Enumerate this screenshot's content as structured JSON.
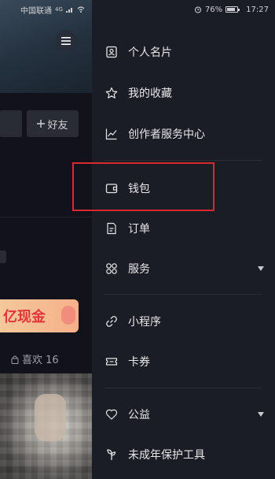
{
  "status_bar": {
    "carrier": "中国联通",
    "network": "4G",
    "battery": "76%",
    "time": "17:27"
  },
  "background_profile": {
    "add_friend_label": "好友",
    "promo_text": "亿现金",
    "likes_label": "喜欢 16"
  },
  "drawer": {
    "items": [
      {
        "label": "个人名片",
        "icon": "card-icon"
      },
      {
        "label": "我的收藏",
        "icon": "star-icon"
      },
      {
        "label": "创作者服务中心",
        "icon": "chart-icon"
      },
      {
        "label": "钱包",
        "icon": "wallet-icon"
      },
      {
        "label": "订单",
        "icon": "order-icon"
      },
      {
        "label": "服务",
        "icon": "grid-icon"
      },
      {
        "label": "小程序",
        "icon": "link-icon"
      },
      {
        "label": "卡券",
        "icon": "ticket-icon"
      },
      {
        "label": "公益",
        "icon": "heart-icon"
      },
      {
        "label": "未成年保护工具",
        "icon": "sprout-icon"
      }
    ]
  },
  "colors": {
    "drawer_bg": "#1b1d26",
    "highlight": "#d9282e",
    "promo_text": "#e0353a"
  }
}
